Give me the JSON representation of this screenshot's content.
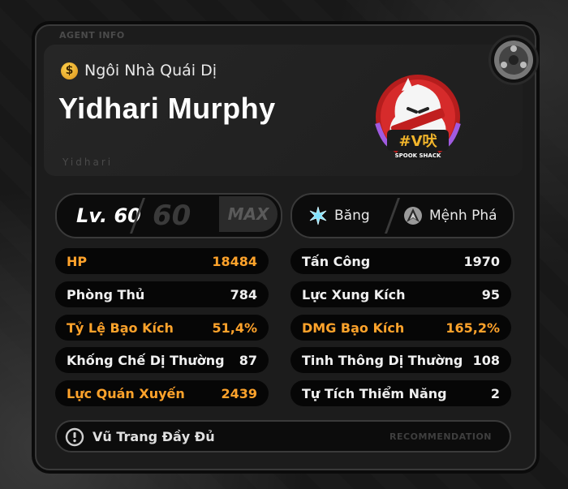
{
  "agent_info_label": "AGENT INFO",
  "faction": "Ngôi Nhà Quái Dị",
  "name": "Yidhari Murphy",
  "sub_name": "Yidhari",
  "logo_text": "SPOOK SHACK",
  "level": {
    "label": "Lv. 60",
    "max_level": "60",
    "max_badge": "MAX"
  },
  "attribute": {
    "label": "Băng",
    "icon": "ice-icon",
    "color": "#7fe3ff"
  },
  "specialty": {
    "label": "Mệnh Phá",
    "icon": "rupture-icon"
  },
  "stats_left": [
    {
      "label": "HP",
      "value": "18484",
      "highlight": true
    },
    {
      "label": "Phòng Thủ",
      "value": "784",
      "highlight": false
    },
    {
      "label": "Tỷ Lệ Bạo Kích",
      "value": "51,4%",
      "highlight": true
    },
    {
      "label": "Khống Chế Dị Thường",
      "value": "87",
      "highlight": false
    },
    {
      "label": "Lực Quán Xuyến",
      "value": "2439",
      "highlight": true
    }
  ],
  "stats_right": [
    {
      "label": "Tấn Công",
      "value": "1970",
      "highlight": false
    },
    {
      "label": "Lực Xung Kích",
      "value": "95",
      "highlight": false
    },
    {
      "label": "DMG Bạo Kích",
      "value": "165,2%",
      "highlight": true
    },
    {
      "label": "Tinh Thông Dị Thường",
      "value": "108",
      "highlight": false
    },
    {
      "label": "Tự Tích Thiểm Năng",
      "value": "2",
      "highlight": false
    }
  ],
  "weapon": {
    "label": "Vũ Trang Đầy Đủ",
    "recommendation": "RECOMMENDATION"
  },
  "colors": {
    "highlight": "#ffa32b",
    "accent_coin": "#f2b52b"
  }
}
